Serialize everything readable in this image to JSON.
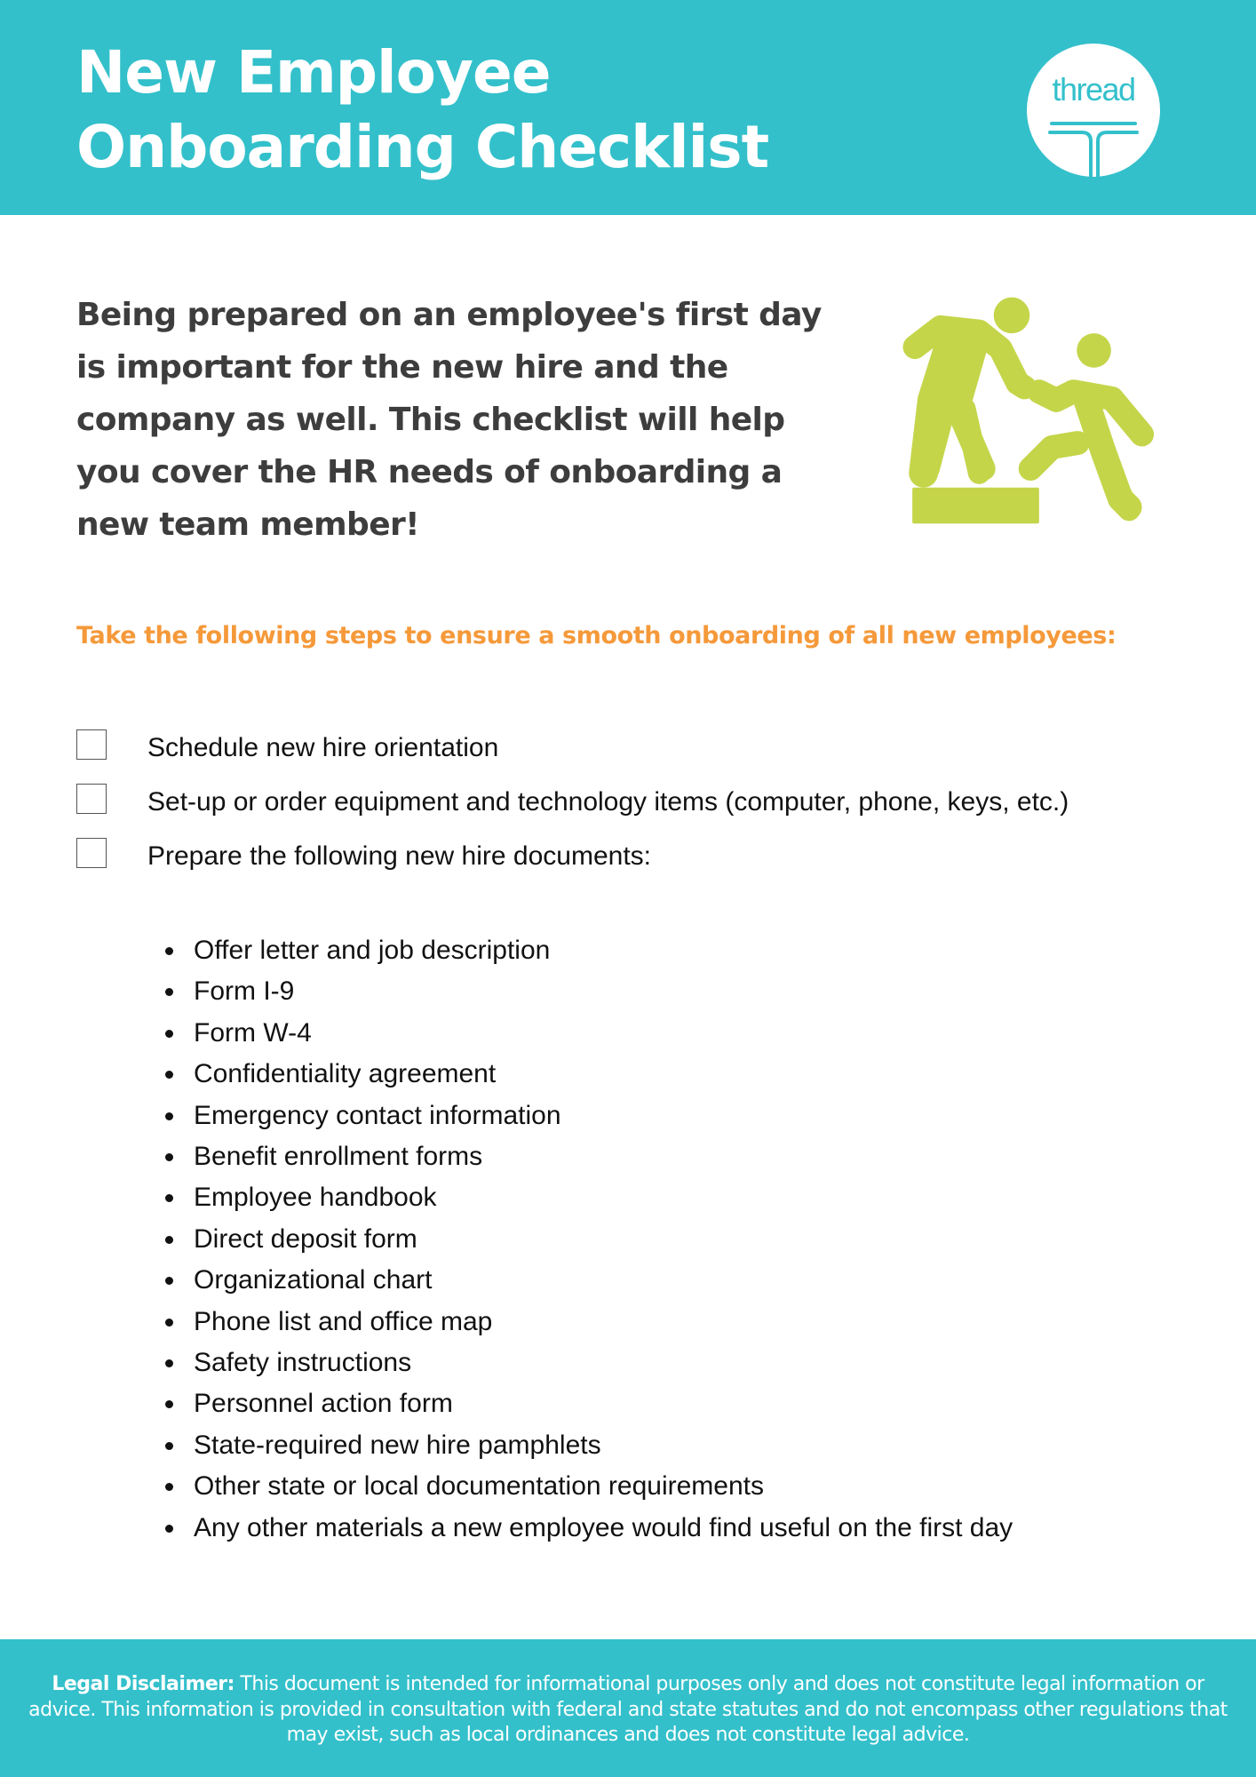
{
  "header": {
    "title_line1": "New Employee",
    "title_line2": "Onboarding Checklist",
    "logo_text": "thread",
    "colors": {
      "banner": "#33c0cb",
      "accent_orange": "#f5993a",
      "illustration_green": "#c5d54a"
    }
  },
  "intro": {
    "text": "Being prepared on an employee's first day is important for the new hire and the company as well. This checklist will help you cover the HR needs of onboarding a new team member!",
    "illustration_icon": "helping-hand-climb-icon"
  },
  "subheading": "Take the following steps to ensure a smooth onboarding of all new employees:",
  "checklist": [
    {
      "label": "Schedule new hire orientation",
      "checked": false
    },
    {
      "label": "Set-up or order equipment and technology items (computer, phone, keys, etc.)",
      "checked": false
    },
    {
      "label": "Prepare the following new hire documents:",
      "checked": false
    }
  ],
  "documents": [
    "Offer letter and job description",
    "Form I-9",
    "Form W-4",
    "Confidentiality agreement",
    "Emergency contact information",
    "Benefit enrollment forms",
    "Employee handbook",
    "Direct deposit form",
    "Organizational chart",
    "Phone list and office map",
    "Safety instructions",
    "Personnel action form",
    "State-required new hire pamphlets",
    "Other state or local documentation requirements",
    "Any other materials a new employee would find useful on the first day"
  ],
  "footer": {
    "disclaimer_label": "Legal Disclaimer:",
    "disclaimer_text": " This document is intended for informational purposes only and does not constitute legal information or advice. This information is provided in consultation with federal and state statutes and do not encompass other regulations that may exist, such as local ordinances and does not constitute legal advice."
  }
}
